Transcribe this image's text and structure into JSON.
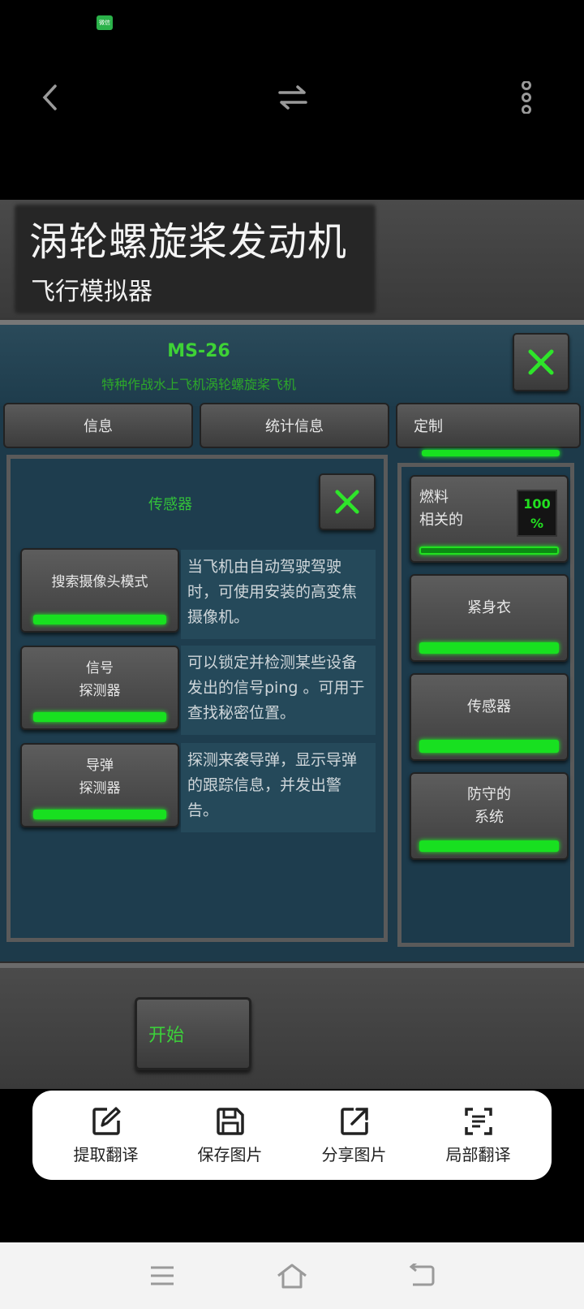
{
  "status": {
    "badge_text": "微信"
  },
  "topbar": {
    "back_icon": "chevron-left-icon",
    "switch_icon": "swap-arrows-icon",
    "more_icon": "more-vertical-icon"
  },
  "game": {
    "title": "涡轮螺旋桨发动机",
    "subtitle": "飞行模拟器",
    "model": "MS-26",
    "model_desc": "特种作战水上飞机涡轮螺旋桨飞机",
    "tabs": [
      "信息",
      "统计信息",
      "定制"
    ],
    "sub_panel_title": "传感器",
    "items": [
      {
        "label": "搜索摄像头模式",
        "desc": "当飞机由自动驾驶驾驶时，可使用安装的高变焦摄像机。"
      },
      {
        "label": "信号\n探测器",
        "desc": "可以锁定并检测某些设备发出的信号ping 。可用于查找秘密位置。"
      },
      {
        "label": "导弹\n探测器",
        "desc": "探测来袭导弹，显示导弹的跟踪信息，并发出警告。"
      }
    ],
    "right_items": [
      {
        "label": "燃料\n相关的",
        "value": "100\n%"
      },
      {
        "label": "紧身衣"
      },
      {
        "label": "传感器"
      },
      {
        "label": "防守的\n系统"
      }
    ],
    "start_label": "开始",
    "accent_green": "#1ae021"
  },
  "actions": [
    {
      "label": "提取翻译",
      "icon": "edit-icon"
    },
    {
      "label": "保存图片",
      "icon": "save-icon"
    },
    {
      "label": "分享图片",
      "icon": "share-icon"
    },
    {
      "label": "局部翻译",
      "icon": "scan-icon"
    }
  ],
  "navbar": {
    "menu_icon": "menu-icon",
    "home_icon": "home-icon",
    "back_icon": "back-icon"
  }
}
